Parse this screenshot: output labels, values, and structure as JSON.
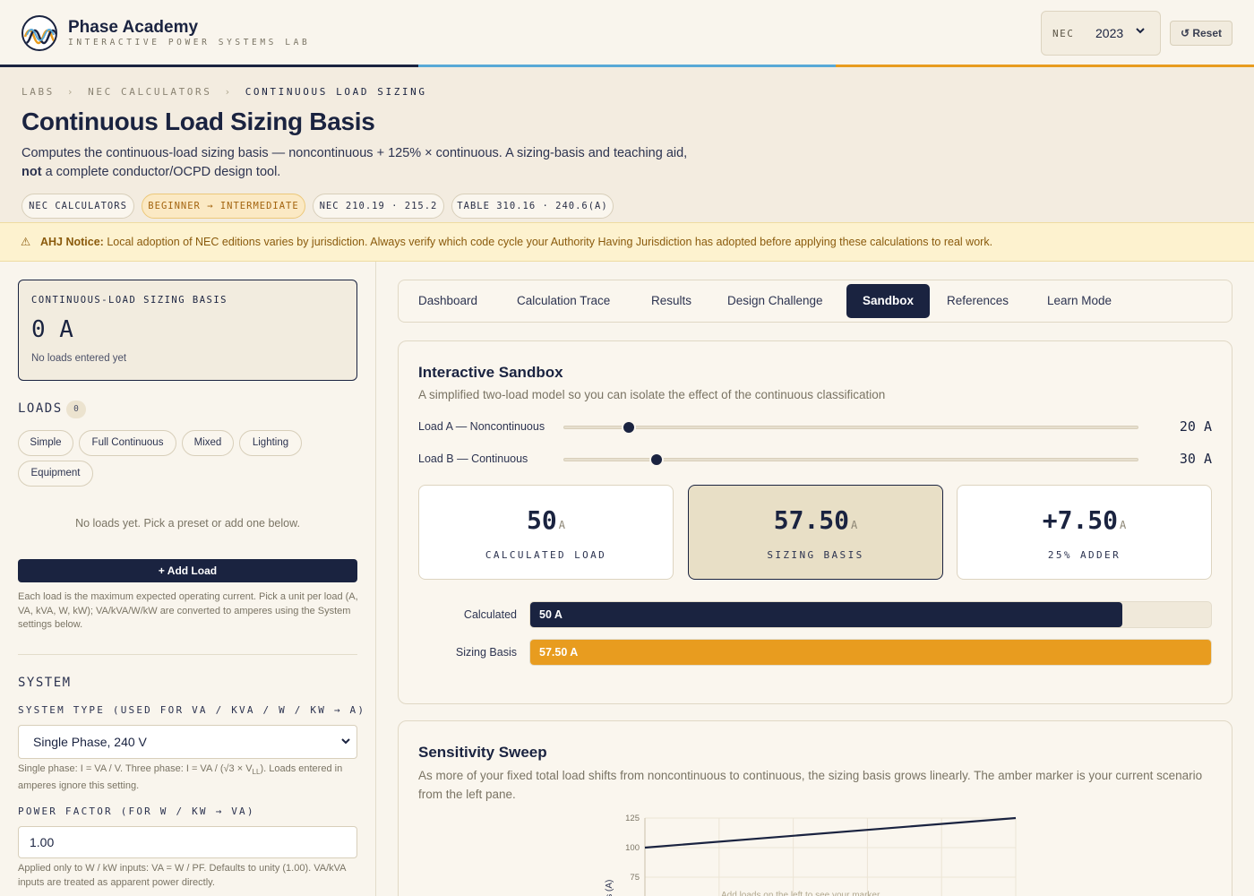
{
  "app": {
    "name": "Phase Academy",
    "tagline": "INTERACTIVE POWER SYSTEMS LAB"
  },
  "header": {
    "nec_label": "NEC",
    "nec_value": "2023",
    "reset_label": "↺ Reset"
  },
  "breadcrumb": [
    "LABS",
    "NEC CALCULATORS",
    "CONTINUOUS LOAD SIZING"
  ],
  "page": {
    "title": "Continuous Load Sizing Basis",
    "desc_part1": "Computes the continuous-load sizing basis — noncontinuous + 125% × continuous. A sizing-basis and teaching aid,",
    "desc_bold": "not",
    "desc_part2": "a complete conductor/OCPD design tool.",
    "tags": [
      "NEC CALCULATORS",
      "BEGINNER → INTERMEDIATE",
      "NEC 210.19 · 215.2",
      "TABLE 310.16 · 240.6(A)"
    ]
  },
  "notice": {
    "icon": "warning-icon",
    "label": "AHJ Notice:",
    "text": "Local adoption of NEC editions varies by jurisdiction. Always verify which code cycle your Authority Having Jurisdiction has adopted before applying these calculations to real work."
  },
  "left": {
    "basis_card": {
      "key": "CONTINUOUS-LOAD SIZING BASIS",
      "value": "0 A",
      "sub": "No loads entered yet"
    },
    "loads_heading": "LOADS",
    "loads_count": "0",
    "presets": [
      "Simple",
      "Full Continuous",
      "Mixed",
      "Lighting",
      "Equipment"
    ],
    "empty_msg": "No loads yet. Pick a preset or add one below.",
    "add_label": "+ Add Load",
    "add_help": "Each load is the maximum expected operating current. Pick a unit per load (A, VA, kVA, W, kW); VA/kVA/W/kW are converted to amperes using the System settings below.",
    "system_heading": "SYSTEM",
    "system_type_label": "SYSTEM TYPE (USED FOR VA / KVA / W / KW → A)",
    "system_type_value": "Single Phase, 240 V",
    "system_help_a": "Single phase: I = VA / V. Three phase: I = VA / (√3 × V",
    "system_help_sub": "LL",
    "system_help_b": "). Loads entered in amperes ignore this setting.",
    "pf_label": "POWER FACTOR (FOR W / KW → VA)",
    "pf_value": "1.00",
    "pf_help": "Applied only to W / kW inputs: VA = W / PF. Defaults to unity (1.00). VA/kVA inputs are treated as apparent power directly."
  },
  "tabs": [
    {
      "label": "Dashboard",
      "active": false
    },
    {
      "label": "Calculation Trace",
      "active": false
    },
    {
      "label": "Results",
      "active": false
    },
    {
      "label": "Design Challenge",
      "active": false
    },
    {
      "label": "Sandbox",
      "active": true
    },
    {
      "label": "References",
      "active": false
    },
    {
      "label": "Learn Mode",
      "active": false
    }
  ],
  "sandbox": {
    "title": "Interactive Sandbox",
    "subtitle": "A simplified two-load model so you can isolate the effect of the continuous classification",
    "load_a_label": "Load A — Noncontinuous",
    "load_a_value": "20 A",
    "load_a_fraction": 0.112,
    "load_b_label": "Load B — Continuous",
    "load_b_value": "30 A",
    "load_b_fraction": 0.161,
    "stats": [
      {
        "value": "50",
        "unit": "A",
        "caption": "CALCULATED LOAD"
      },
      {
        "value": "57.50",
        "unit": "A",
        "caption": "SIZING BASIS"
      },
      {
        "value": "+7.50",
        "unit": "A",
        "caption": "25% ADDER"
      }
    ],
    "bars": [
      {
        "label": "Calculated",
        "value": "50 A",
        "amount": 50,
        "color": "#1a2340"
      },
      {
        "label": "Sizing Basis",
        "value": "57.50 A",
        "amount": 57.5,
        "color": "#e89c1f"
      }
    ],
    "bar_max": 57.5
  },
  "sweep": {
    "title": "Sensitivity Sweep",
    "subtitle": "As more of your fixed total load shifts from noncontinuous to continuous, the sizing basis grows linearly. The amber marker is your current scenario from the left pane.",
    "ylabel": "is (A)",
    "overlay_text": "Add loads on the left to see your marker"
  },
  "chart_data": {
    "type": "line",
    "title": "",
    "xlabel": "",
    "ylabel": "is (A)",
    "x": [
      0,
      100
    ],
    "series": [
      {
        "values": [
          100,
          125
        ]
      }
    ],
    "yticks": [
      75,
      100,
      125
    ],
    "ylim": [
      50,
      125
    ],
    "grid": true
  },
  "colors": {
    "navy": "#1a2340",
    "amber": "#e89c1f",
    "stripe_blue": "#58a9d6",
    "stripe_orange": "#e89c1f"
  }
}
